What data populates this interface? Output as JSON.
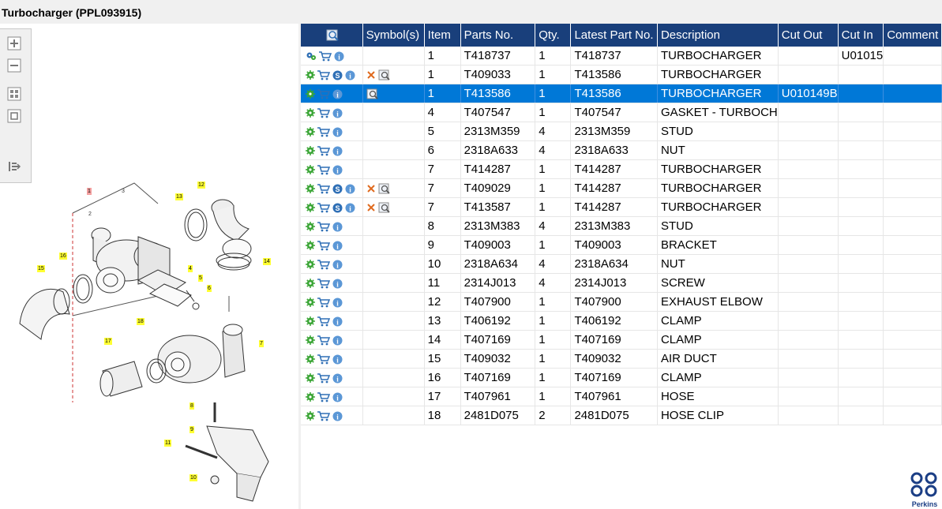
{
  "title": "Turbocharger (PPL093915)",
  "columns": [
    "",
    "Symbol(s)",
    "Item",
    "Parts No.",
    "Qty.",
    "Latest Part No.",
    "Description",
    "Cut Out",
    "Cut In",
    "Comment"
  ],
  "rows": [
    {
      "item": "1",
      "part": "T418737",
      "qty": "1",
      "latest": "T418737",
      "desc": "TURBOCHARGER",
      "cutout": "",
      "cutin": "U01015",
      "comment": "",
      "sym": false,
      "s": false,
      "variant": "gears"
    },
    {
      "item": "1",
      "part": "T409033",
      "qty": "1",
      "latest": "T413586",
      "desc": "TURBOCHARGER",
      "cutout": "",
      "cutin": "",
      "comment": "",
      "sym": true,
      "s": true,
      "variant": "gear"
    },
    {
      "item": "1",
      "part": "T413586",
      "qty": "1",
      "latest": "T413586",
      "desc": "TURBOCHARGER",
      "cutout": "U010149B",
      "cutin": "",
      "comment": "",
      "sym": false,
      "symlook": true,
      "s": false,
      "variant": "gear",
      "selected": true
    },
    {
      "item": "4",
      "part": "T407547",
      "qty": "1",
      "latest": "T407547",
      "desc": "GASKET - TURBOCH",
      "cutout": "",
      "cutin": "",
      "comment": "",
      "sym": false,
      "s": false,
      "variant": "gear"
    },
    {
      "item": "5",
      "part": "2313M359",
      "qty": "4",
      "latest": "2313M359",
      "desc": "STUD",
      "cutout": "",
      "cutin": "",
      "comment": "",
      "sym": false,
      "s": false,
      "variant": "gear"
    },
    {
      "item": "6",
      "part": "2318A633",
      "qty": "4",
      "latest": "2318A633",
      "desc": "NUT",
      "cutout": "",
      "cutin": "",
      "comment": "",
      "sym": false,
      "s": false,
      "variant": "gear"
    },
    {
      "item": "7",
      "part": "T414287",
      "qty": "1",
      "latest": "T414287",
      "desc": "TURBOCHARGER",
      "cutout": "",
      "cutin": "",
      "comment": "",
      "sym": false,
      "s": false,
      "variant": "gear"
    },
    {
      "item": "7",
      "part": "T409029",
      "qty": "1",
      "latest": "T414287",
      "desc": "TURBOCHARGER",
      "cutout": "",
      "cutin": "",
      "comment": "",
      "sym": true,
      "s": true,
      "variant": "gear"
    },
    {
      "item": "7",
      "part": "T413587",
      "qty": "1",
      "latest": "T414287",
      "desc": "TURBOCHARGER",
      "cutout": "",
      "cutin": "",
      "comment": "",
      "sym": true,
      "s": true,
      "variant": "gear"
    },
    {
      "item": "8",
      "part": "2313M383",
      "qty": "4",
      "latest": "2313M383",
      "desc": "STUD",
      "cutout": "",
      "cutin": "",
      "comment": "",
      "sym": false,
      "s": false,
      "variant": "gear"
    },
    {
      "item": "9",
      "part": "T409003",
      "qty": "1",
      "latest": "T409003",
      "desc": "BRACKET",
      "cutout": "",
      "cutin": "",
      "comment": "",
      "sym": false,
      "s": false,
      "variant": "gear"
    },
    {
      "item": "10",
      "part": "2318A634",
      "qty": "4",
      "latest": "2318A634",
      "desc": "NUT",
      "cutout": "",
      "cutin": "",
      "comment": "",
      "sym": false,
      "s": false,
      "variant": "gear"
    },
    {
      "item": "11",
      "part": "2314J013",
      "qty": "4",
      "latest": "2314J013",
      "desc": "SCREW",
      "cutout": "",
      "cutin": "",
      "comment": "",
      "sym": false,
      "s": false,
      "variant": "gear"
    },
    {
      "item": "12",
      "part": "T407900",
      "qty": "1",
      "latest": "T407900",
      "desc": "EXHAUST ELBOW",
      "cutout": "",
      "cutin": "",
      "comment": "",
      "sym": false,
      "s": false,
      "variant": "gear"
    },
    {
      "item": "13",
      "part": "T406192",
      "qty": "1",
      "latest": "T406192",
      "desc": "CLAMP",
      "cutout": "",
      "cutin": "",
      "comment": "",
      "sym": false,
      "s": false,
      "variant": "gear"
    },
    {
      "item": "14",
      "part": "T407169",
      "qty": "1",
      "latest": "T407169",
      "desc": "CLAMP",
      "cutout": "",
      "cutin": "",
      "comment": "",
      "sym": false,
      "s": false,
      "variant": "gear"
    },
    {
      "item": "15",
      "part": "T409032",
      "qty": "1",
      "latest": "T409032",
      "desc": "AIR DUCT",
      "cutout": "",
      "cutin": "",
      "comment": "",
      "sym": false,
      "s": false,
      "variant": "gear"
    },
    {
      "item": "16",
      "part": "T407169",
      "qty": "1",
      "latest": "T407169",
      "desc": "CLAMP",
      "cutout": "",
      "cutin": "",
      "comment": "",
      "sym": false,
      "s": false,
      "variant": "gear"
    },
    {
      "item": "17",
      "part": "T407961",
      "qty": "1",
      "latest": "T407961",
      "desc": "HOSE",
      "cutout": "",
      "cutin": "",
      "comment": "",
      "sym": false,
      "s": false,
      "variant": "gear"
    },
    {
      "item": "18",
      "part": "2481D075",
      "qty": "2",
      "latest": "2481D075",
      "desc": "HOSE CLIP",
      "cutout": "",
      "cutin": "",
      "comment": "",
      "sym": false,
      "s": false,
      "variant": "gear"
    }
  ],
  "diagram_callouts": [
    "1",
    "2",
    "3",
    "4",
    "5",
    "6",
    "7",
    "8",
    "9",
    "10",
    "11",
    "12",
    "13",
    "14",
    "15",
    "16",
    "17",
    "18"
  ],
  "logo_text": "Perkins",
  "colors": {
    "header": "#193f7b",
    "selected": "#0078d7",
    "gear": "#3aa535",
    "cart": "#2f6fb5",
    "info": "#5b97d6",
    "cross": "#e06a1e"
  }
}
